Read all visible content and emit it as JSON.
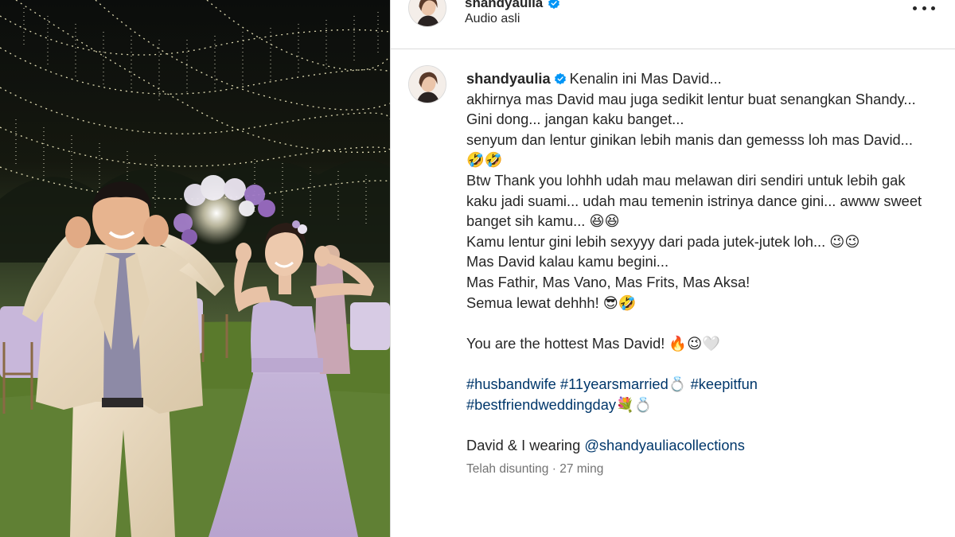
{
  "post": {
    "author": {
      "username": "shandyaulia",
      "verified": true,
      "audio_label": "Audio asli"
    },
    "caption": {
      "first_line": "Kenalin ini Mas David...",
      "lines": [
        "akhirnya mas David mau juga sedikit lentur buat senangkan Shandy...",
        "Gini dong... jangan kaku banget...",
        "senyum dan lentur ginikan lebih manis dan gemesss loh mas David...",
        "🤣🤣",
        "Btw Thank you lohhh udah mau melawan diri sendiri untuk lebih gak kaku jadi suami... udah mau temenin istrinya dance gini... awww sweet banget sih kamu... 😆😆",
        "Kamu lentur gini lebih sexyyy dari pada jutek-jutek loh... 😉😉",
        "Mas David kalau kamu begini...",
        "Mas Fathir, Mas Vano, Mas Frits, Mas Aksa!",
        "Semua lewat dehhh! 😎🤣"
      ],
      "hottest_line": "You are the hottest Mas David! 🔥😉🤍",
      "hashtags_line1": [
        "#husbandwife",
        "#11yearsmarried💍",
        "#keepitfun"
      ],
      "hashtags_line2": [
        "#bestfriendweddingday💐💍"
      ],
      "wearing_prefix": "David & I wearing ",
      "wearing_mention": "@shandyauliacollections"
    },
    "meta": {
      "edited": "Telah disunting",
      "separator": " · ",
      "time": "27 ming"
    }
  },
  "icons": {
    "verified": "verified-badge-icon",
    "more": "more-options-icon"
  },
  "colors": {
    "text": "#262626",
    "link": "#00376b",
    "muted": "#737373",
    "verified": "#0095f6",
    "divider": "#dbdbdb"
  }
}
